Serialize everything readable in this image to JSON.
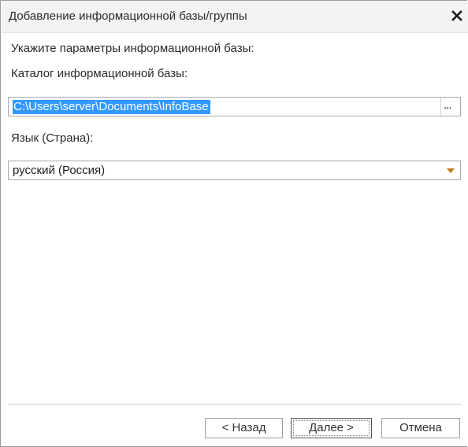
{
  "window": {
    "title": "Добавление информационной базы/группы"
  },
  "form": {
    "heading": "Укажите параметры информационной базы:",
    "catalog_label": "Каталог информационной базы:",
    "catalog_value": "C:\\Users\\server\\Documents\\InfoBase",
    "catalog_browse_label": "...",
    "language_label": "Язык (Страна):",
    "language_value": "русский (Россия)"
  },
  "buttons": {
    "back": "< Назад",
    "next": "Далее >",
    "cancel": "Отмена"
  },
  "colors": {
    "selection": "#3399ff",
    "dropdown_arrow": "#c07a18"
  },
  "icons": {
    "close": "close-icon",
    "dropdown": "chevron-down-icon"
  }
}
